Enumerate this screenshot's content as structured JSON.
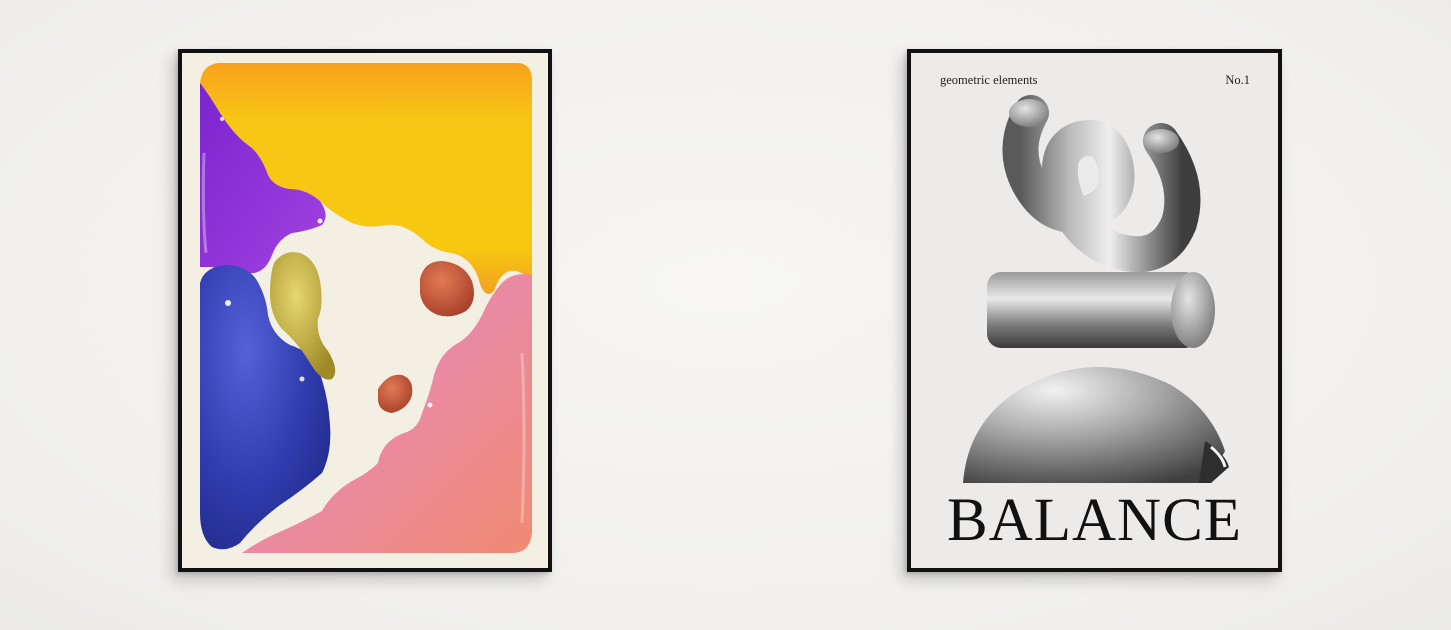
{
  "posters": {
    "left": {
      "palette": {
        "yellow": "#f5c50f",
        "orange": "#f39a1e",
        "purple": "#8a2bd6",
        "blue": "#2b3aa8",
        "pink": "#e8879d",
        "gold": "#c9b43a",
        "terracotta": "#c9553a",
        "paper": "#f3efe2"
      }
    },
    "right": {
      "header_left": "geometric elements",
      "header_right": "No.1",
      "title": "BALANCE",
      "palette": {
        "paper": "#ecebea",
        "ink": "#111111"
      }
    }
  },
  "frame_color": "#111111",
  "wall_color": "#f4f3f1"
}
